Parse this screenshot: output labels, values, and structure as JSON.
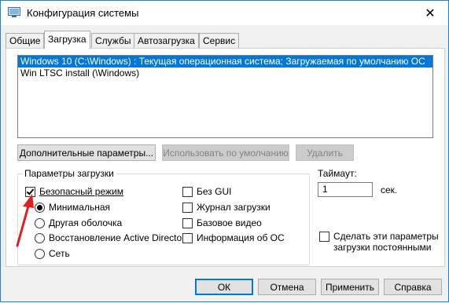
{
  "window": {
    "title": "Конфигурация системы",
    "close_symbol": "✕"
  },
  "tabs": [
    "Общие",
    "Загрузка",
    "Службы",
    "Автозагрузка",
    "Сервис"
  ],
  "active_tab": "Загрузка",
  "os_list": [
    "Windows 10 (C:\\Windows) : Текущая операционная система; Загружаемая по умолчанию ОС",
    "Win LTSC install (\\Windows)"
  ],
  "buttons": {
    "advanced": "Дополнительные параметры...",
    "set_default": "Использовать по умолчанию",
    "delete": "Удалить"
  },
  "boot_options": {
    "title": "Параметры загрузки",
    "safe_mode": "Безопасный режим",
    "minimal": "Минимальная",
    "alternate_shell": "Другая оболочка",
    "ad_repair": "Восстановление Active Directory",
    "network": "Сеть",
    "no_gui": "Без GUI",
    "boot_log": "Журнал загрузки",
    "base_video": "Базовое видео",
    "os_boot_info": "Информация  об ОС"
  },
  "timeout": {
    "label": "Таймаут:",
    "value": "1",
    "unit": "сек."
  },
  "permanent": {
    "line1": "Сделать эти параметры",
    "line2": "загрузки постоянными"
  },
  "footer": {
    "ok": "ОК",
    "cancel": "Отмена",
    "apply": "Применить",
    "help": "Справка"
  },
  "colors": {
    "accent": "#0078d7",
    "arrow": "#e02020"
  }
}
